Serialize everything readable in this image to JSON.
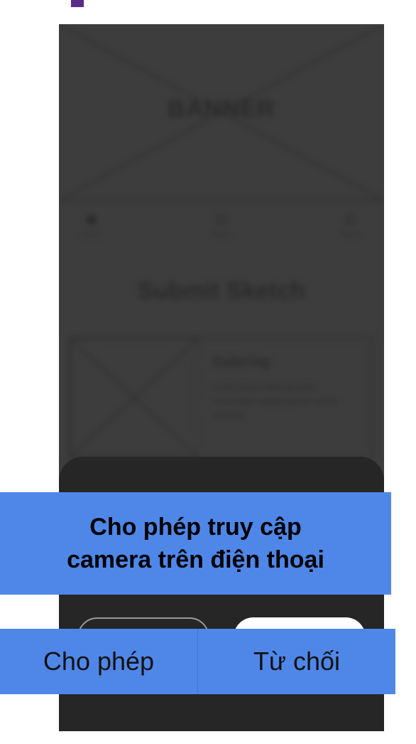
{
  "background": {
    "banner_label": "BANNER",
    "menu_items": [
      "Item 1",
      "Item 2",
      "Item 3"
    ],
    "section_title": "Submit Sketch",
    "card": {
      "title": "Coloring",
      "text": "Lorem ipsum dolor sit amet consectetur adipiscing elit sed do eiusmod"
    }
  },
  "dialog": {
    "message_line1": "Cho phép truy cập",
    "message_line2": "camera trên điện thoại",
    "allow_label": "Cho phép",
    "deny_label": "Từ chối"
  },
  "colors": {
    "accent": "#5b2a86",
    "overlay_blue": "#4f87e8",
    "sheet": "#262626",
    "dimmed_bg": "#3d3d3d"
  }
}
